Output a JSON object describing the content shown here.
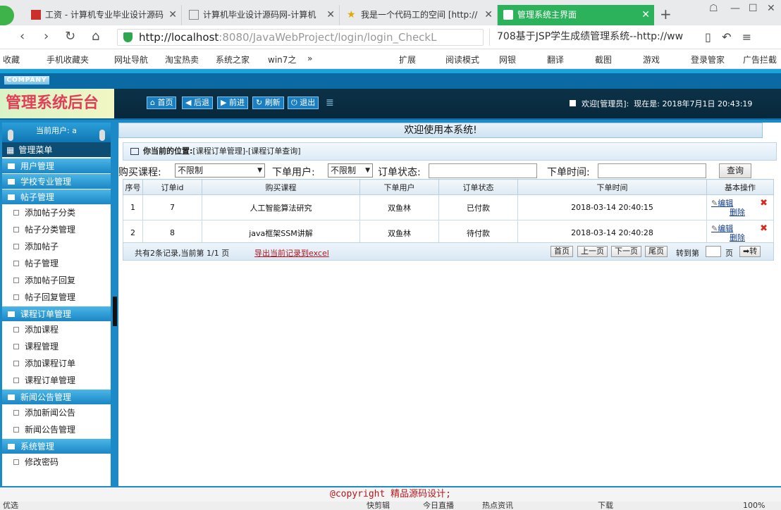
{
  "browser": {
    "tabs": [
      {
        "label": "工资 - 计算机专业毕业设计源码"
      },
      {
        "label": "计算机毕业设计源码网-计算机"
      },
      {
        "label": "我是一个代码工的空间 [http://"
      },
      {
        "label": "管理系统主界面"
      }
    ],
    "url_host": "http://localhost",
    "url_rest": ":8080/JavaWebProject/login/login_CheckL",
    "search_text": "708基于JSP学生成绩管理系统--http://ww",
    "bookmarks": [
      "收藏",
      "手机收藏夹",
      "网址导航",
      "淘宝热卖",
      "系统之家",
      "win7之",
      "»",
      "扩展",
      "阅读模式",
      "网银",
      "翻译",
      "截图",
      "游戏",
      "登录管家",
      "广告拦截"
    ],
    "status_left": "优选",
    "status_items": [
      "快剪辑",
      "今日直播",
      "热点资讯",
      "下载",
      "100%"
    ]
  },
  "app": {
    "company": "COMPANY",
    "title": "管理系统后台",
    "toolbar": [
      "首页",
      "后退",
      "前进",
      "刷新",
      "退出"
    ],
    "welcome_user": "欢迎[管理员]:",
    "now_label": "现在是:",
    "now_value": "2018年7月1日 20:43:19",
    "sidebar": {
      "current_user": "当前用户: a",
      "menu_title": "管理菜单",
      "groups": [
        {
          "label": "用户管理",
          "items": []
        },
        {
          "label": "学校专业管理",
          "items": []
        },
        {
          "label": "帖子管理",
          "items": [
            "添加帖子分类",
            "帖子分类管理",
            "添加帖子",
            "帖子管理",
            "添加帖子回复",
            "帖子回复管理"
          ]
        },
        {
          "label": "课程订单管理",
          "items": [
            "添加课程",
            "课程管理",
            "添加课程订单",
            "课程订单管理"
          ]
        },
        {
          "label": "新闻公告管理",
          "items": [
            "添加新闻公告",
            "新闻公告管理"
          ]
        },
        {
          "label": "系统管理",
          "items": [
            "修改密码"
          ]
        }
      ]
    },
    "welcome_text": "欢迎使用本系统!",
    "location_label": "你当前的位置:",
    "location_path": "[课程订单管理]-[课程订单查询]",
    "filters": {
      "course_label": "购买课程:",
      "course_value": "不限制",
      "user_label": "下单用户:",
      "user_value": "不限制",
      "state_label": "订单状态:",
      "state_value": "",
      "time_label": "下单时间:",
      "time_value": "",
      "query_button": "查询"
    },
    "table": {
      "headers": [
        "序号",
        "订单id",
        "购买课程",
        "下单用户",
        "订单状态",
        "下单时间",
        "基本操作"
      ],
      "rows": [
        {
          "no": "1",
          "id": "7",
          "course": "人工智能算法研究",
          "user": "双鱼林",
          "state": "已付款",
          "time": "2018-03-14 20:40:15"
        },
        {
          "no": "2",
          "id": "8",
          "course": "java框架SSM讲解",
          "user": "双鱼林",
          "state": "待付款",
          "time": "2018-03-14 20:40:28"
        }
      ],
      "edit_label": "编辑",
      "delete_label": "删除"
    },
    "pager": {
      "info": "共有2条记录,当前第 1/1 页",
      "export": "导出当前记录到excel",
      "first": "首页",
      "prev": "上一页",
      "next": "下一页",
      "last": "尾页",
      "goto_label": "转到第",
      "page_unit": "页",
      "go": "转"
    },
    "footer": "@copyright 精品源码设计;"
  }
}
